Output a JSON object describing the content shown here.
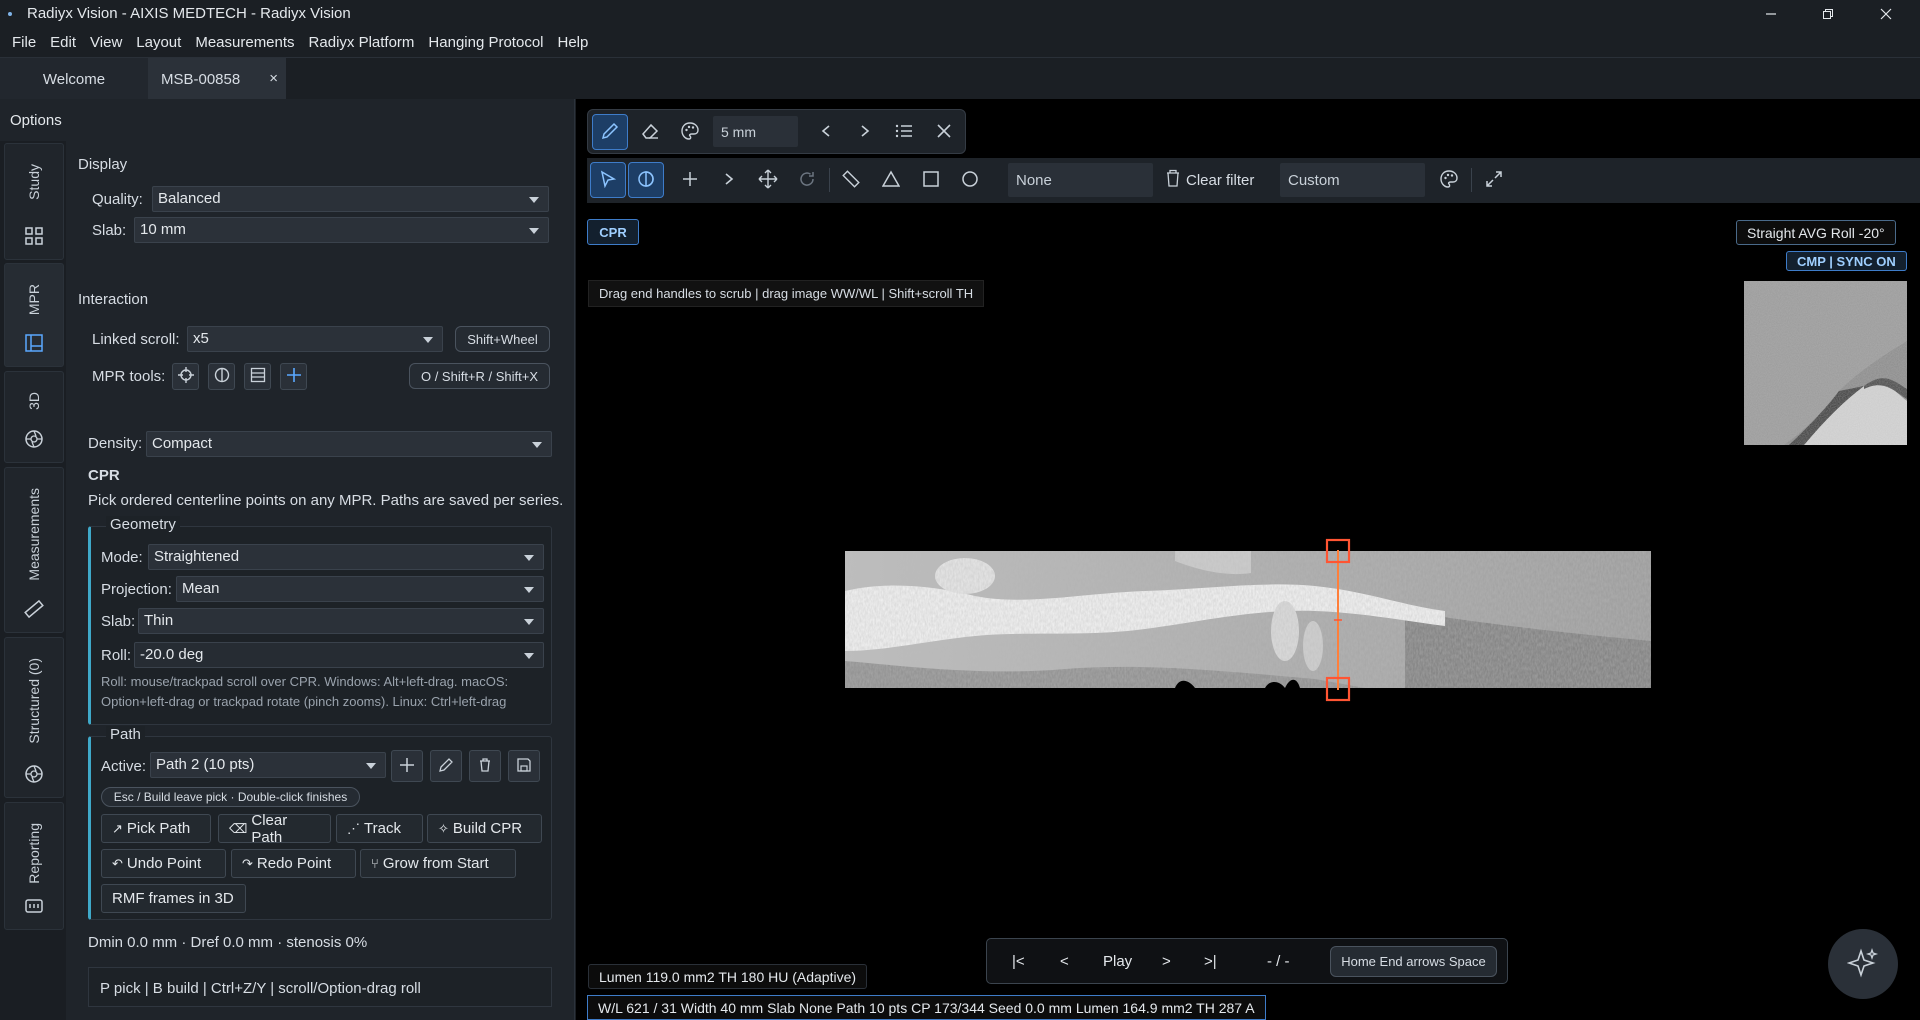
{
  "window": {
    "title": "Radiyx Vision - AIXIS MEDTECH - Radiyx Vision"
  },
  "menu": [
    "File",
    "Edit",
    "View",
    "Layout",
    "Measurements",
    "Radiyx Platform",
    "Hanging Protocol",
    "Help"
  ],
  "tabs": [
    {
      "label": "Welcome"
    },
    {
      "label": "MSB-00858",
      "close": "×"
    }
  ],
  "options": {
    "title": "Options",
    "vtabs": [
      {
        "label": "Study",
        "icon": "grid-icon"
      },
      {
        "label": "MPR",
        "icon": "mpr-icon"
      },
      {
        "label": "3D",
        "icon": "aperture-icon"
      },
      {
        "label": "Measurements",
        "icon": "ruler-icon"
      },
      {
        "label": "Structured (0)",
        "icon": "aperture-icon"
      },
      {
        "label": "Reporting",
        "icon": "report-icon"
      }
    ],
    "display": {
      "heading": "Display",
      "quality_label": "Quality:",
      "quality_value": "Balanced",
      "slab_label": "Slab:",
      "slab_value": "10 mm"
    },
    "interaction": {
      "heading": "Interaction",
      "linked_label": "Linked scroll:",
      "linked_value": "x5",
      "shift_wheel": "Shift+Wheel",
      "mpr_tools_label": "MPR tools:",
      "shortcut": "O / Shift+R / Shift+X"
    },
    "density": {
      "label": "Density:",
      "value": "Compact"
    },
    "cpr": {
      "heading": "CPR",
      "desc": "Pick ordered centerline points on any MPR. Paths are saved per series.",
      "geometry": {
        "heading": "Geometry",
        "mode_label": "Mode:",
        "mode_value": "Straightened",
        "proj_label": "Projection:",
        "proj_value": "Mean",
        "slab_label": "Slab:",
        "slab_value": "Thin",
        "roll_label": "Roll:",
        "roll_value": "-20.0 deg",
        "roll_help": "Roll: mouse/trackpad scroll over CPR. Windows: Alt+left-drag. macOS: Option+left-drag or trackpad rotate (pinch zooms). Linux: Ctrl+left-drag"
      },
      "path": {
        "heading": "Path",
        "active_label": "Active:",
        "active_value": "Path 2 (10 pts)",
        "esc_hint": "Esc / Build leave pick · Double-click finishes",
        "pick": "Pick Path",
        "clear": "Clear Path",
        "track": "Track",
        "build": "Build CPR",
        "undo": "Undo Point",
        "redo": "Redo Point",
        "grow": "Grow from Start",
        "rmf": "RMF frames in 3D"
      },
      "metrics": "Dmin 0.0 mm  ·  Dref 0.0 mm  ·  stenosis 0%",
      "shortcuts": "P pick | B build | Ctrl+Z/Y | scroll/Option-drag roll"
    }
  },
  "viewer": {
    "toolbarA": {
      "thickness": "5 mm"
    },
    "toolbarB": {
      "filter": "None",
      "clear_filter": "Clear filter",
      "preset": "Custom"
    },
    "cpr_tag": "CPR",
    "hint": "Drag end handles to scrub  |  drag image WW/WL  |  Shift+scroll TH",
    "overlay_tr": "Straight  AVG  Roll -20°",
    "sync": "CMP | SYNC ON",
    "lumen": "Lumen 119.0 mm2  TH 180 HU  (Adaptive)",
    "nav": {
      "first": "|<",
      "prev": "<",
      "play": "Play",
      "next": ">",
      "last": ">|",
      "frame": "- / -",
      "keys": "Home End  arrows  Space"
    },
    "status": "W/L 621 / 31  Width 40 mm  Slab None  Path 10 pts  CP 173/344  Seed 0.0 mm  Lumen 164.9 mm2  TH 287 A"
  },
  "colors": {
    "accent": "#3e7cc9",
    "handle": "#ff5533",
    "group_border": "#3fa9c9"
  }
}
